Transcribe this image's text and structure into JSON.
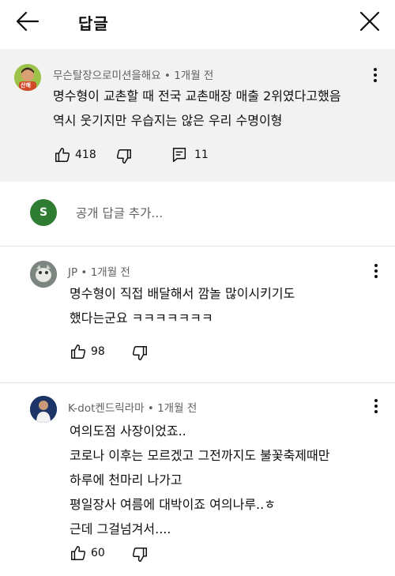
{
  "header": {
    "title": "답글",
    "back_icon": "arrow-left-icon",
    "close_icon": "close-icon"
  },
  "top_comment": {
    "author": "무슨탈장으로미션을해요",
    "time": "1개월 전",
    "avatar_label": "산해",
    "lines": [
      "명수형이 교촌할 때 전국 교촌매장 매출 2위였다고했음",
      "역시 웃기지만 우습지는 않은 우리 수명이형"
    ],
    "likes": "418",
    "replies": "11"
  },
  "add_reply": {
    "avatar_letter": "S",
    "placeholder": "공개 답글 추가..."
  },
  "replies": [
    {
      "author": "JP",
      "time": "1개월 전",
      "lines": [
        "명수형이 직접 배달해서 깜놀 많이시키기도",
        "했다는군요 ㅋㅋㅋㅋㅋㅋㅋ"
      ],
      "likes": "98"
    },
    {
      "author": "K-dot켄드릭라마",
      "time": "1개월 전",
      "lines": [
        "여의도점 사장이었죠..",
        "코로나 이후는 모르겠고 그전까지도 불꽃축제때만",
        "하루에 천마리 나가고",
        "평일장사 여름에 대박이죠 여의나루..ㅎ",
        "근데 그걸넘겨서...."
      ],
      "likes": "60"
    }
  ],
  "colors": {
    "top_comment_bg": "#f2f2f2",
    "meta_text": "#606060",
    "reply_avatar_bg": "#2e7d32"
  }
}
